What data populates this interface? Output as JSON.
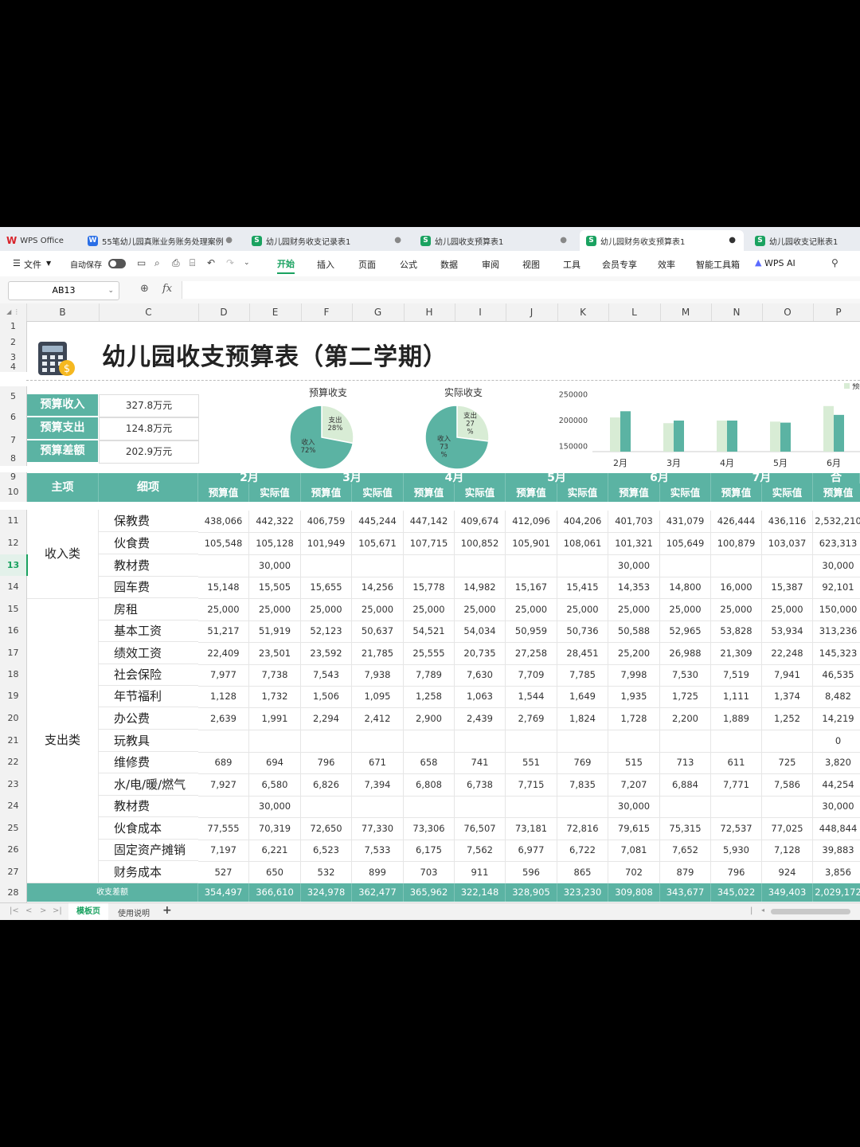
{
  "tabs": [
    {
      "label": "WPS Office",
      "kind": "wps"
    },
    {
      "label": "55笔幼儿园真账业务账务处理案例",
      "kind": "W"
    },
    {
      "label": "幼儿园财务收支记录表1",
      "kind": "S"
    },
    {
      "label": "幼儿园收支预算表1",
      "kind": "S"
    },
    {
      "label": "幼儿园财务收支预算表1",
      "kind": "S"
    },
    {
      "label": "幼儿园收支记账表1",
      "kind": "S"
    }
  ],
  "ribbon": {
    "file": "文件",
    "autosave": "自动保存",
    "menus": [
      "开始",
      "插入",
      "页面",
      "公式",
      "数据",
      "审阅",
      "视图",
      "工具",
      "会员专享",
      "效率",
      "智能工具箱",
      "WPS AI"
    ]
  },
  "namebox": "AB13",
  "fx": "fx",
  "columns": [
    "B",
    "C",
    "D",
    "E",
    "F",
    "G",
    "H",
    "I",
    "J",
    "K",
    "L",
    "M",
    "N",
    "O",
    "P"
  ],
  "rows": [
    "1",
    "2",
    "3",
    "4",
    "5",
    "6",
    "7",
    "8",
    "9",
    "10",
    "11",
    "12",
    "13",
    "14",
    "15",
    "16",
    "17",
    "18",
    "19",
    "20",
    "21",
    "22",
    "23",
    "24",
    "25",
    "26",
    "27",
    "28"
  ],
  "sheet_title": "幼儿园收支预算表（第二学期）",
  "kpis": [
    {
      "label": "预算收入",
      "value": "327.8万元"
    },
    {
      "label": "预算支出",
      "value": "124.8万元"
    },
    {
      "label": "预算差额",
      "value": "202.9万元"
    }
  ],
  "colors": {
    "teal": "#5bb3a3",
    "pale": "#d8ecd5",
    "sel": "#1aa260"
  },
  "chart_data": [
    {
      "type": "pie",
      "title": "预算收支",
      "slices": [
        {
          "name": "支出",
          "label": "28%",
          "value": 28
        },
        {
          "name": "收入",
          "label": "72%",
          "value": 72
        }
      ]
    },
    {
      "type": "pie",
      "title": "实际收支",
      "slices": [
        {
          "name": "支出",
          "label": "27\n%",
          "value": 27
        },
        {
          "name": "收入",
          "label": "73\n%",
          "value": 73
        }
      ]
    },
    {
      "type": "bar",
      "title": "",
      "categories": [
        "2月",
        "3月",
        "4月",
        "5月",
        "6月"
      ],
      "legend": "预",
      "yticks": [
        "250000",
        "200000",
        "150000"
      ],
      "ylim": [
        140000,
        260000
      ],
      "series": [
        {
          "values": [
            206000,
            195000,
            200000,
            198000,
            228000
          ]
        },
        {
          "values": [
            218000,
            200000,
            200000,
            196000,
            211000
          ]
        }
      ]
    }
  ],
  "table": {
    "h_main": "主项",
    "h_sub": "细项",
    "months": [
      "2月",
      "3月",
      "4月",
      "5月",
      "6月",
      "7月",
      "合"
    ],
    "sub_headers": [
      "预算值",
      "实际值",
      "预算值",
      "实际值",
      "预算值",
      "实际值",
      "预算值",
      "实际值",
      "预算值",
      "实际值",
      "预算值",
      "实际值",
      "预算值"
    ],
    "groups": [
      {
        "name": "收入类",
        "rows": 4
      },
      {
        "name": "支出类",
        "rows": 13
      }
    ],
    "rows": [
      {
        "label": "保教费",
        "values": [
          "438,066",
          "442,322",
          "406,759",
          "445,244",
          "447,142",
          "409,674",
          "412,096",
          "404,206",
          "401,703",
          "431,079",
          "426,444",
          "436,116",
          "2,532,210"
        ]
      },
      {
        "label": "伙食费",
        "values": [
          "105,548",
          "105,128",
          "101,949",
          "105,671",
          "107,715",
          "100,852",
          "105,901",
          "108,061",
          "101,321",
          "105,649",
          "100,879",
          "103,037",
          "623,313"
        ]
      },
      {
        "label": "教材费",
        "values": [
          "",
          "30,000",
          "",
          "",
          "",
          "",
          "",
          "",
          "30,000",
          "",
          "",
          "",
          "30,000"
        ]
      },
      {
        "label": "园车费",
        "values": [
          "15,148",
          "15,505",
          "15,655",
          "14,256",
          "15,778",
          "14,982",
          "15,167",
          "15,415",
          "14,353",
          "14,800",
          "16,000",
          "15,387",
          "92,101"
        ]
      },
      {
        "label": "房租",
        "values": [
          "25,000",
          "25,000",
          "25,000",
          "25,000",
          "25,000",
          "25,000",
          "25,000",
          "25,000",
          "25,000",
          "25,000",
          "25,000",
          "25,000",
          "150,000"
        ]
      },
      {
        "label": "基本工资",
        "values": [
          "51,217",
          "51,919",
          "52,123",
          "50,637",
          "54,521",
          "54,034",
          "50,959",
          "50,736",
          "50,588",
          "52,965",
          "53,828",
          "53,934",
          "313,236"
        ]
      },
      {
        "label": "绩效工资",
        "values": [
          "22,409",
          "23,501",
          "23,592",
          "21,785",
          "25,555",
          "20,735",
          "27,258",
          "28,451",
          "25,200",
          "26,988",
          "21,309",
          "22,248",
          "145,323"
        ]
      },
      {
        "label": "社会保险",
        "values": [
          "7,977",
          "7,738",
          "7,543",
          "7,938",
          "7,789",
          "7,630",
          "7,709",
          "7,785",
          "7,998",
          "7,530",
          "7,519",
          "7,941",
          "46,535"
        ]
      },
      {
        "label": "年节福利",
        "values": [
          "1,128",
          "1,732",
          "1,506",
          "1,095",
          "1,258",
          "1,063",
          "1,544",
          "1,649",
          "1,935",
          "1,725",
          "1,111",
          "1,374",
          "8,482"
        ]
      },
      {
        "label": "办公费",
        "values": [
          "2,639",
          "1,991",
          "2,294",
          "2,412",
          "2,900",
          "2,439",
          "2,769",
          "1,824",
          "1,728",
          "2,200",
          "1,889",
          "1,252",
          "14,219"
        ]
      },
      {
        "label": "玩教具",
        "values": [
          "",
          "",
          "",
          "",
          "",
          "",
          "",
          "",
          "",
          "",
          "",
          "",
          "0"
        ]
      },
      {
        "label": "维修费",
        "values": [
          "689",
          "694",
          "796",
          "671",
          "658",
          "741",
          "551",
          "769",
          "515",
          "713",
          "611",
          "725",
          "3,820"
        ]
      },
      {
        "label": "水/电/暖/燃气",
        "values": [
          "7,927",
          "6,580",
          "6,826",
          "7,394",
          "6,808",
          "6,738",
          "7,715",
          "7,835",
          "7,207",
          "6,884",
          "7,771",
          "7,586",
          "44,254"
        ]
      },
      {
        "label": "教材费",
        "values": [
          "",
          "30,000",
          "",
          "",
          "",
          "",
          "",
          "",
          "30,000",
          "",
          "",
          "",
          "30,000"
        ]
      },
      {
        "label": "伙食成本",
        "values": [
          "77,555",
          "70,319",
          "72,650",
          "77,330",
          "73,306",
          "76,507",
          "73,181",
          "72,816",
          "79,615",
          "75,315",
          "72,537",
          "77,025",
          "448,844"
        ]
      },
      {
        "label": "固定资产摊销",
        "values": [
          "7,197",
          "6,221",
          "6,523",
          "7,533",
          "6,175",
          "7,562",
          "6,977",
          "6,722",
          "7,081",
          "7,652",
          "5,930",
          "7,128",
          "39,883"
        ]
      },
      {
        "label": "财务成本",
        "values": [
          "527",
          "650",
          "532",
          "899",
          "703",
          "911",
          "596",
          "865",
          "702",
          "879",
          "796",
          "924",
          "3,856"
        ]
      }
    ],
    "footer": {
      "label": "收支差额",
      "values": [
        "354,497",
        "366,610",
        "324,978",
        "362,477",
        "365,962",
        "322,148",
        "328,905",
        "323,230",
        "309,808",
        "343,677",
        "345,022",
        "349,403",
        "2,029,172"
      ]
    }
  },
  "sheet_tabs": [
    "模板页",
    "使用说明"
  ],
  "add_sheet": "+"
}
